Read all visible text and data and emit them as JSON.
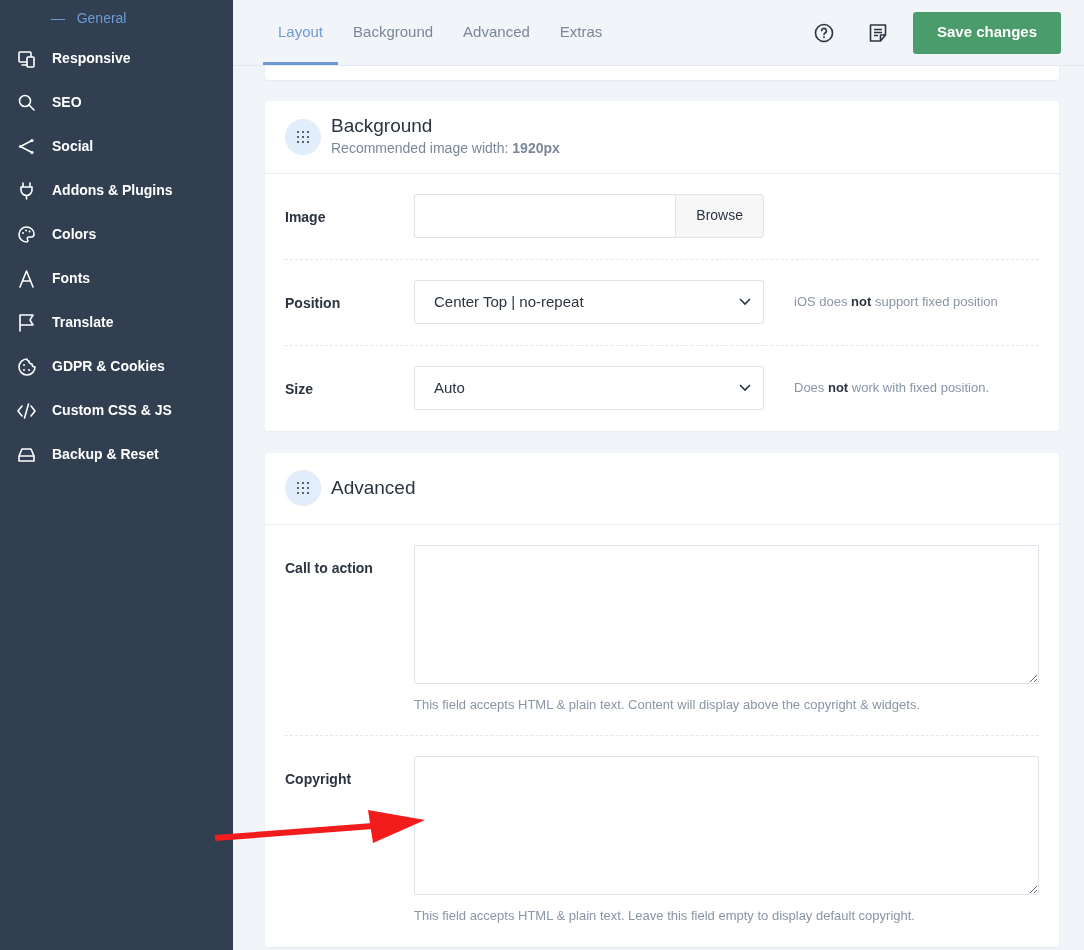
{
  "sidebar": {
    "subitem": {
      "dash": "—",
      "label": "General",
      "selected": true
    },
    "items": [
      {
        "label": "Responsive"
      },
      {
        "label": "SEO"
      },
      {
        "label": "Social"
      },
      {
        "label": "Addons & Plugins"
      },
      {
        "label": "Colors"
      },
      {
        "label": "Fonts"
      },
      {
        "label": "Translate"
      },
      {
        "label": "GDPR & Cookies"
      },
      {
        "label": "Custom CSS & JS"
      },
      {
        "label": "Backup & Reset"
      }
    ]
  },
  "tabs": [
    {
      "label": "Layout",
      "selected": true
    },
    {
      "label": "Background",
      "selected": false
    },
    {
      "label": "Advanced",
      "selected": false
    },
    {
      "label": "Extras",
      "selected": false
    }
  ],
  "save_button": "Save changes",
  "sections": [
    {
      "title": "Background",
      "subtitle": "Recommended image width: **1920px**",
      "fields": [
        {
          "kind": "file",
          "label": "Image",
          "button": "Browse"
        },
        {
          "kind": "select",
          "label": "Position",
          "value": "Center Top | no-repeat",
          "hint": "iOS does **not** support fixed position"
        },
        {
          "kind": "select",
          "label": "Size",
          "value": "Auto",
          "hint": "Does **not** work with fixed position."
        }
      ]
    },
    {
      "title": "Advanced",
      "fields": [
        {
          "kind": "textarea",
          "label": "Call to action",
          "hint": "This field accepts HTML & plain text. Content will display above the copyright & widgets."
        },
        {
          "kind": "textarea",
          "label": "Copyright",
          "hint": "This field accepts HTML & plain text. Leave this field empty to display default copyright."
        }
      ]
    }
  ]
}
